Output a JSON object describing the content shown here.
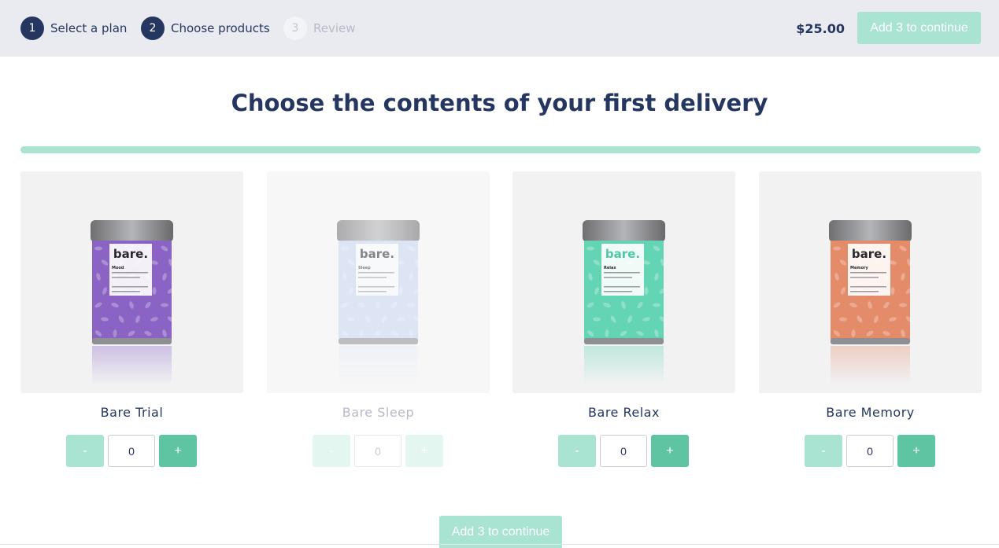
{
  "steps": [
    {
      "number": "1",
      "label": "Select a plan",
      "state": "done"
    },
    {
      "number": "2",
      "label": "Choose products",
      "state": "active"
    },
    {
      "number": "3",
      "label": "Review",
      "state": "upcoming"
    }
  ],
  "header": {
    "price": "$25.00",
    "continue_label": "Add 3 to continue"
  },
  "page_title": "Choose the contents of your first delivery",
  "progress": {
    "fraction": 1.0
  },
  "products": [
    {
      "name": "Bare Trial",
      "brand": "bare.",
      "variant": "Mood",
      "tin_color": "#8a63c4",
      "quantity": "0",
      "minus": "-",
      "plus": "+",
      "enabled": true
    },
    {
      "name": "Bare Sleep",
      "brand": "bare.",
      "variant": "Sleep",
      "tin_color": "#c9d8f2",
      "quantity": "0",
      "minus": "-",
      "plus": "+",
      "enabled": false
    },
    {
      "name": "Bare Relax",
      "brand": "bare.",
      "variant": "Relax",
      "tin_color": "#63d4b4",
      "quantity": "0",
      "minus": "-",
      "plus": "+",
      "enabled": true
    },
    {
      "name": "Bare Memory",
      "brand": "bare.",
      "variant": "Memory",
      "tin_color": "#e48b6a",
      "quantity": "0",
      "minus": "-",
      "plus": "+",
      "enabled": true
    }
  ],
  "footer": {
    "continue_label": "Add 3 to continue"
  },
  "colors": {
    "navy": "#253761",
    "mint_light": "#a9e3d2",
    "mint": "#5fc4a2",
    "topbar_bg": "#eaebf0"
  }
}
